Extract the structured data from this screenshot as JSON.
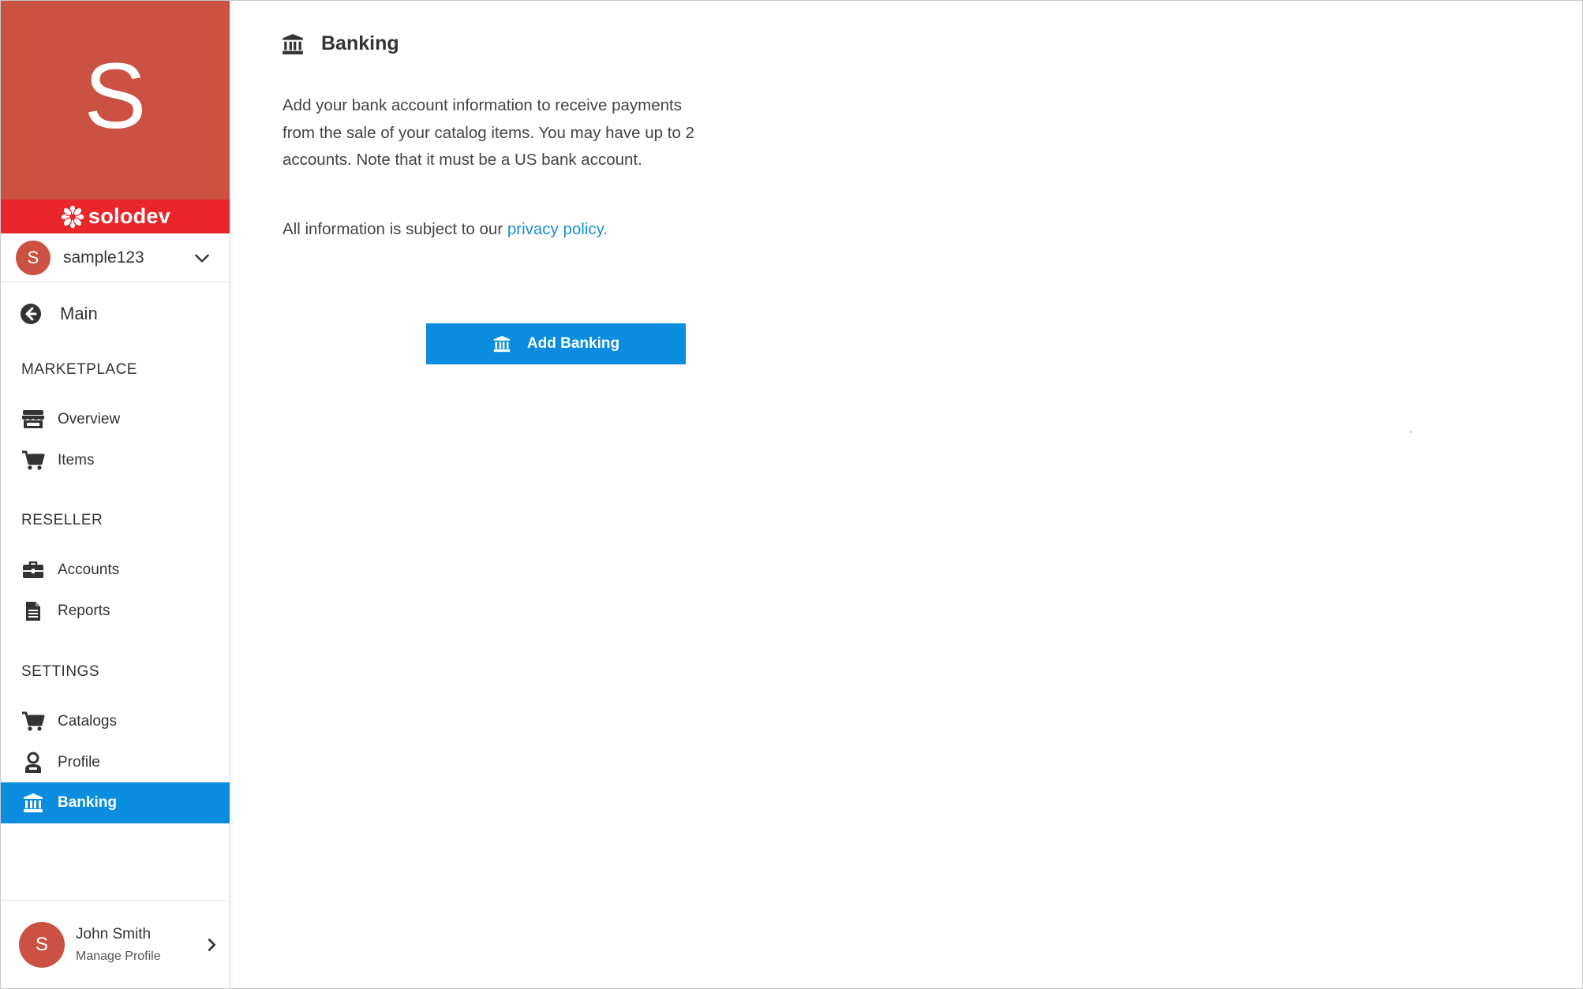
{
  "brand": {
    "letter": "S",
    "logo_text": "solodev",
    "color": "#cb5243",
    "logo_bar_color": "#e8262b"
  },
  "account": {
    "avatar_letter": "S",
    "name": "sample123",
    "dropdown_icon": "chevron-down-icon"
  },
  "nav": {
    "main_label": "Main",
    "main_icon": "arrow-left-circle-icon",
    "sections": [
      {
        "title": "MARKETPLACE",
        "items": [
          {
            "label": "Overview",
            "icon": "store-icon"
          },
          {
            "label": "Items",
            "icon": "cart-icon"
          }
        ]
      },
      {
        "title": "RESELLER",
        "items": [
          {
            "label": "Accounts",
            "icon": "briefcase-icon"
          },
          {
            "label": "Reports",
            "icon": "document-icon"
          }
        ]
      },
      {
        "title": "SETTINGS",
        "items": [
          {
            "label": "Catalogs",
            "icon": "cart-icon"
          },
          {
            "label": "Profile",
            "icon": "user-icon"
          },
          {
            "label": "Banking",
            "icon": "bank-icon",
            "active": true
          }
        ]
      }
    ]
  },
  "profile": {
    "avatar_letter": "S",
    "name": "John Smith",
    "subtitle": "Manage Profile",
    "icon": "chevron-right-icon"
  },
  "page": {
    "title": "Banking",
    "title_icon": "bank-icon",
    "description": "Add your bank account information to receive payments from the sale of your catalog items. You may have up to 2 accounts. Note that it must be a US bank account.",
    "privacy_prefix": "All information is subject to our ",
    "privacy_link": "privacy policy.",
    "add_button_label": "Add Banking",
    "accent_color": "#0a8ddf",
    "link_color": "#1a8fd1"
  }
}
